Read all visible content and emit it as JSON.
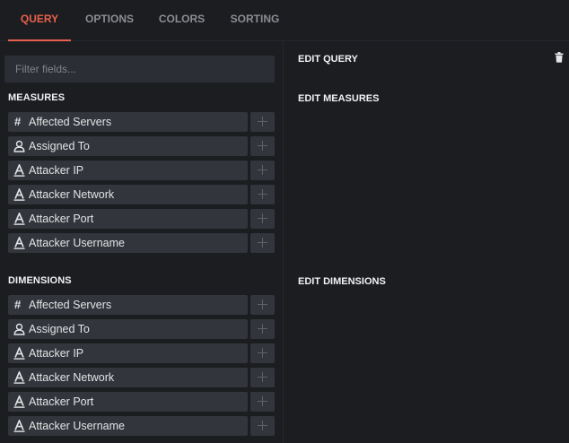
{
  "tabs": [
    {
      "label": "QUERY",
      "active": true
    },
    {
      "label": "OPTIONS",
      "active": false
    },
    {
      "label": "COLORS",
      "active": false
    },
    {
      "label": "SORTING",
      "active": false
    }
  ],
  "filter": {
    "placeholder": "Filter fields...",
    "value": ""
  },
  "measures": {
    "title": "MEASURES",
    "fields": [
      {
        "label": "Affected Servers",
        "icon": "number-icon"
      },
      {
        "label": "Assigned To",
        "icon": "user-icon"
      },
      {
        "label": "Attacker IP",
        "icon": "text-icon"
      },
      {
        "label": "Attacker Network",
        "icon": "text-icon"
      },
      {
        "label": "Attacker Port",
        "icon": "text-icon"
      },
      {
        "label": "Attacker Username",
        "icon": "text-icon"
      }
    ]
  },
  "dimensions": {
    "title": "DIMENSIONS",
    "fields": [
      {
        "label": "Affected Servers",
        "icon": "number-icon"
      },
      {
        "label": "Assigned To",
        "icon": "user-icon"
      },
      {
        "label": "Attacker IP",
        "icon": "text-icon"
      },
      {
        "label": "Attacker Network",
        "icon": "text-icon"
      },
      {
        "label": "Attacker Port",
        "icon": "text-icon"
      },
      {
        "label": "Attacker Username",
        "icon": "text-icon"
      }
    ]
  },
  "right_panel": {
    "edit_query": "EDIT QUERY",
    "edit_measures": "EDIT MEASURES",
    "edit_dimensions": "EDIT DIMENSIONS"
  },
  "colors": {
    "accent": "#e8604c",
    "background": "#1b1d21",
    "field_bg": "#32353b"
  }
}
